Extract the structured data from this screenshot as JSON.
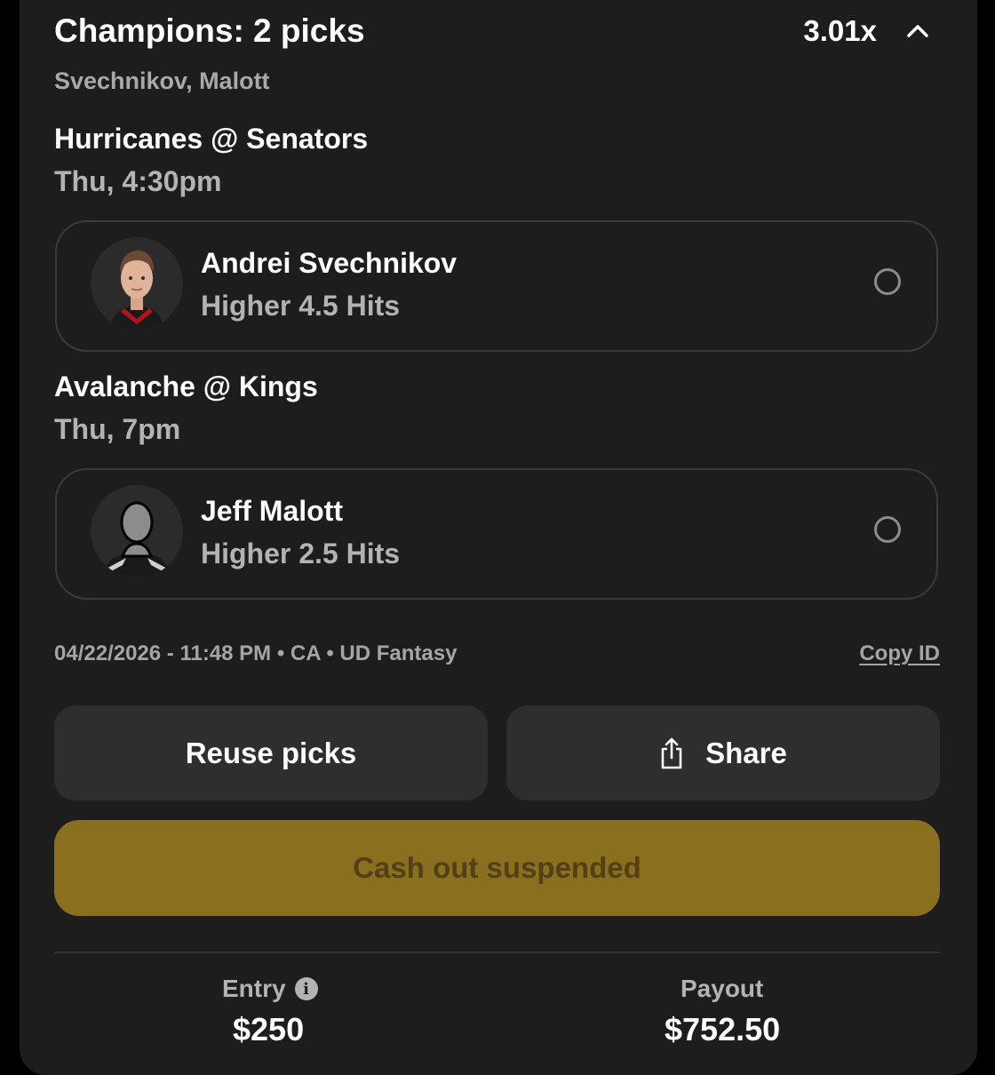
{
  "header": {
    "title": "Champions: 2 picks",
    "multiplier": "3.01x",
    "players_summary": "Svechnikov, Malott"
  },
  "picks": [
    {
      "game": "Hurricanes @ Senators",
      "time": "Thu, 4:30pm",
      "player": "Andrei Svechnikov",
      "line": "Higher 4.5  Hits"
    },
    {
      "game": "Avalanche @ Kings",
      "time": "Thu, 7pm",
      "player": "Jeff Malott",
      "line": "Higher 2.5  Hits"
    }
  ],
  "meta": {
    "info": "04/22/2026 - 11:48 PM • CA • UD Fantasy",
    "copy_id": "Copy ID"
  },
  "actions": {
    "reuse": "Reuse picks",
    "share": "Share",
    "cashout": "Cash out suspended"
  },
  "footer": {
    "entry_label": "Entry",
    "entry_value": "$250",
    "payout_label": "Payout",
    "payout_value": "$752.50"
  },
  "colors": {
    "card_bg": "#1d1d1d",
    "cashout_bg": "#8a6f1e",
    "cashout_text": "#524016",
    "muted_text": "#b3b3b3"
  },
  "icons": [
    "chevron-up-icon",
    "radio-unchecked-icon",
    "share-icon",
    "info-icon"
  ]
}
